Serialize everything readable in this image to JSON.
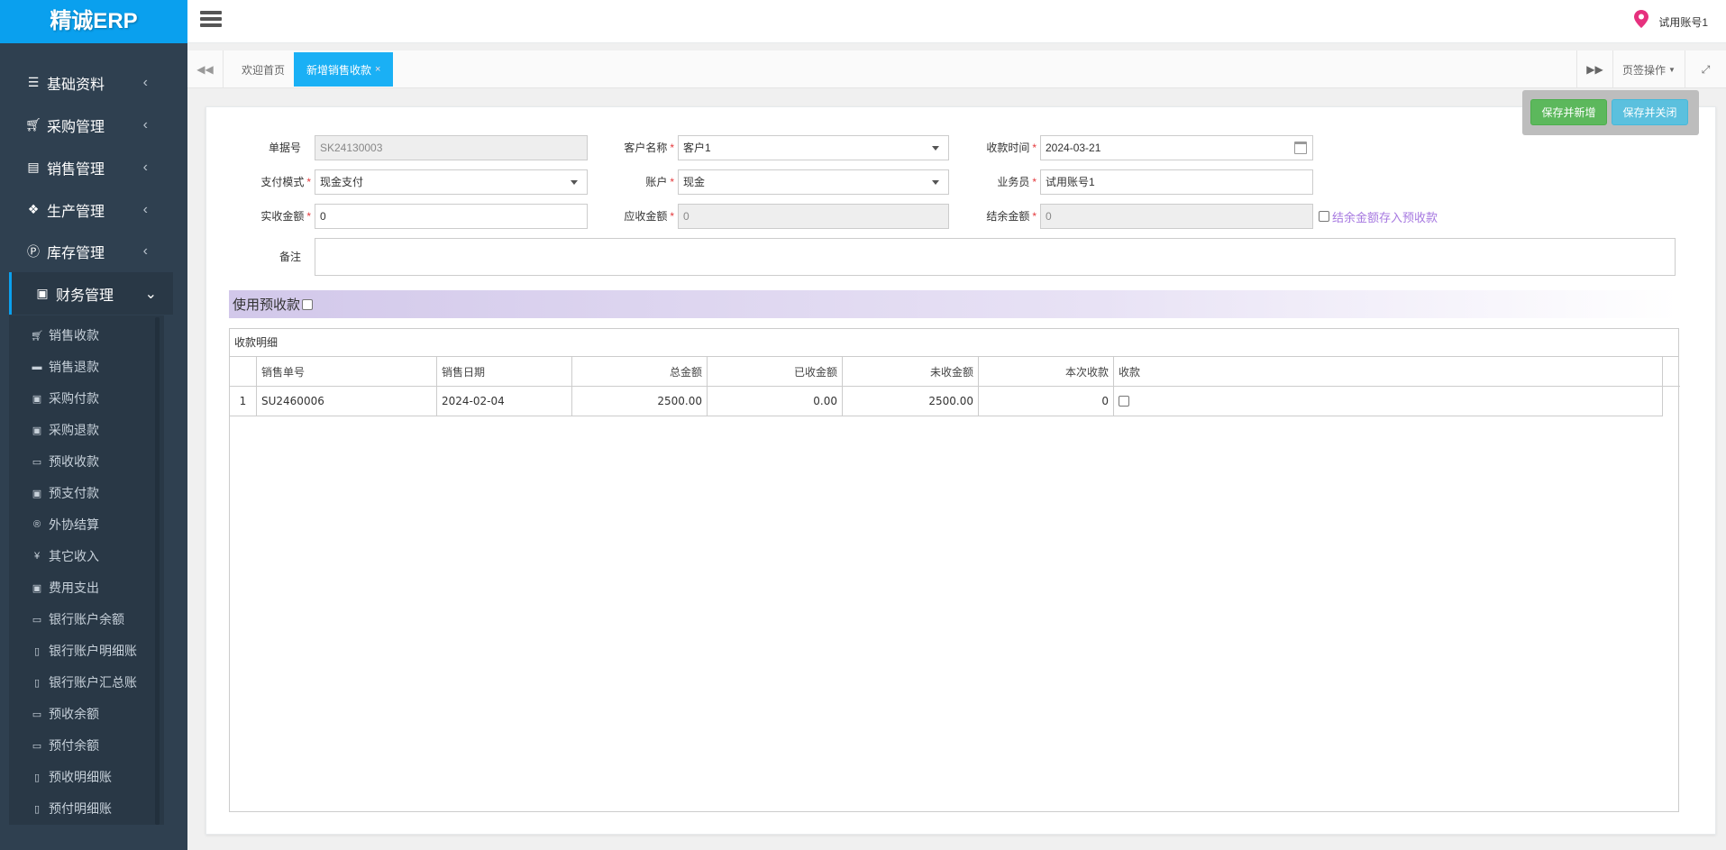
{
  "app": {
    "brand": "精诚ERP"
  },
  "user": {
    "name": "试用账号1"
  },
  "sidebar": {
    "items": [
      {
        "label": "基础资料",
        "icon": "list-icon"
      },
      {
        "label": "采购管理",
        "icon": "cart-icon"
      },
      {
        "label": "销售管理",
        "icon": "book-icon"
      },
      {
        "label": "生产管理",
        "icon": "cubes-icon"
      },
      {
        "label": "库存管理",
        "icon": "product-icon"
      },
      {
        "label": "财务管理",
        "icon": "money-icon"
      }
    ],
    "sub_items": [
      {
        "label": "销售收款"
      },
      {
        "label": "销售退款"
      },
      {
        "label": "采购付款"
      },
      {
        "label": "采购退款"
      },
      {
        "label": "预收收款"
      },
      {
        "label": "预支付款"
      },
      {
        "label": "外协结算"
      },
      {
        "label": "其它收入"
      },
      {
        "label": "费用支出"
      },
      {
        "label": "银行账户余额"
      },
      {
        "label": "银行账户明细账"
      },
      {
        "label": "银行账户汇总账"
      },
      {
        "label": "预收余额"
      },
      {
        "label": "预付余额"
      },
      {
        "label": "预收明细账"
      },
      {
        "label": "预付明细账"
      }
    ]
  },
  "tabs": {
    "home": "欢迎首页",
    "active": "新增销售收款",
    "active_close": "×",
    "ops": "页签操作"
  },
  "toolbar": {
    "save_new": "保存并新增",
    "save_close": "保存并关闭"
  },
  "form": {
    "doc_no_label": "单据号",
    "doc_no": "SK24130003",
    "customer_label": "客户名称",
    "customer": "客户1",
    "date_label": "收款时间",
    "date": "2024-03-21",
    "pay_mode_label": "支付模式",
    "pay_mode": "现金支付",
    "account_label": "账户",
    "account": "现金",
    "salesman_label": "业务员",
    "salesman": "试用账号1",
    "received_label": "实收金额",
    "received": "0",
    "due_label": "应收金额",
    "due": "0",
    "balance_label": "结余金额",
    "balance": "0",
    "save_advance_label": "结余金额存入预收款",
    "remark_label": "备注",
    "remark": ""
  },
  "advance": {
    "label": "使用预收款"
  },
  "detail": {
    "caption": "收款明细",
    "columns": [
      "销售单号",
      "销售日期",
      "总金额",
      "已收金额",
      "未收金额",
      "本次收款",
      "收款"
    ],
    "rows": [
      {
        "no": "1",
        "order": "SU2460006",
        "date": "2024-02-04",
        "total": "2500.00",
        "received": "0.00",
        "unreceived": "2500.00",
        "current": "0"
      }
    ]
  }
}
